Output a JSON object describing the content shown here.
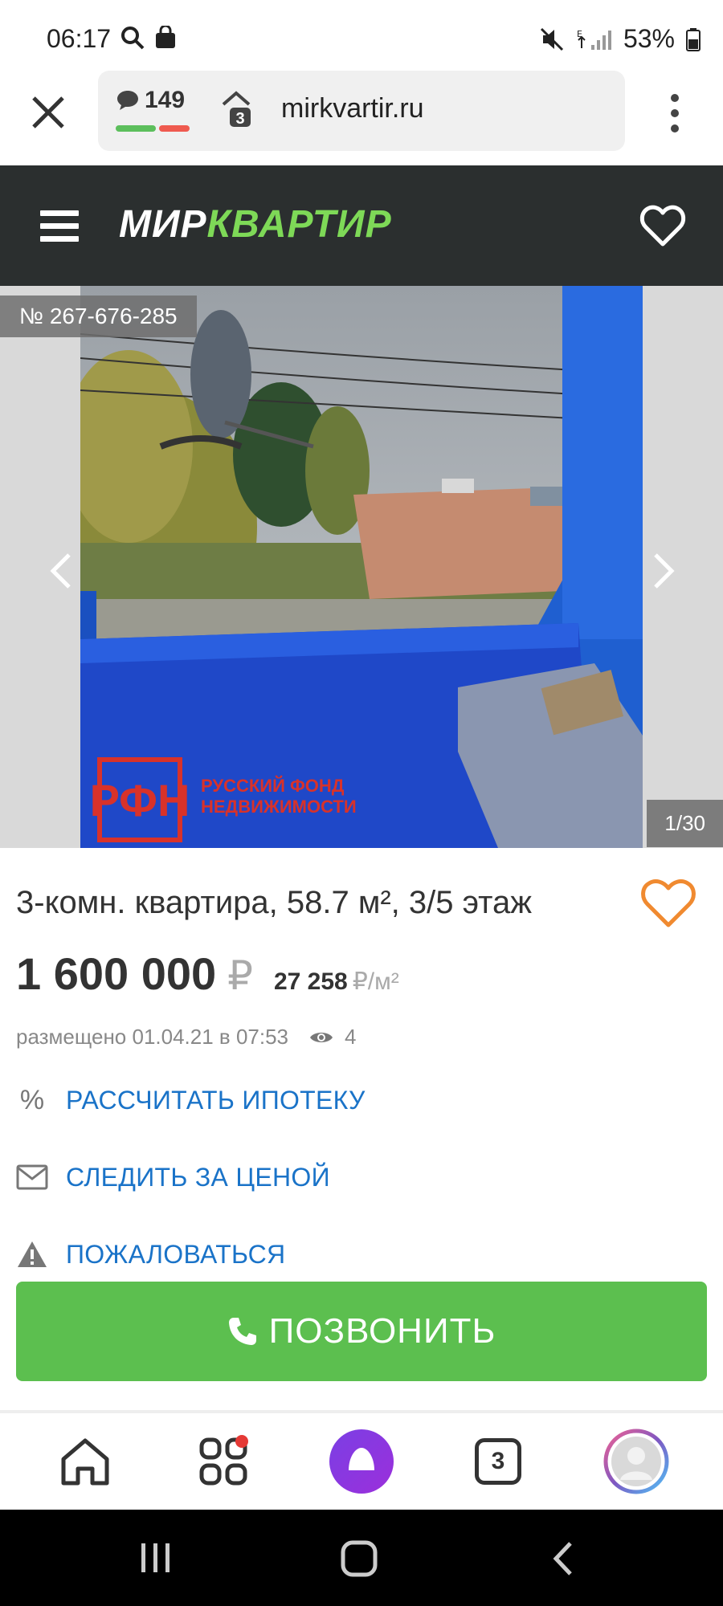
{
  "status_bar": {
    "time": "06:17",
    "battery": "53%"
  },
  "browser": {
    "comments_count": "149",
    "tabs_badge": "3",
    "url": "mirkvartir.ru"
  },
  "site": {
    "logo_part1": "МИР",
    "logo_part2": "КВАРТИР",
    "accent_color": "#7ed957"
  },
  "gallery": {
    "listing_id": "№ 267-676-285",
    "counter": "1/30",
    "watermark": "РУССКИЙ ФОНД НЕДВИЖИМОСТИ"
  },
  "listing": {
    "title": "3-комн. квартира, 58.7 м², 3/5 этаж",
    "price": "1 600 000",
    "currency": "₽",
    "price_per_m": "27 258",
    "price_per_m_unit": "₽/м²",
    "posted": "размещено 01.04.21 в 07:53",
    "views": "4"
  },
  "actions": {
    "mortgage_icon": "%",
    "mortgage": "РАССЧИТАТЬ ИПОТЕКУ",
    "track_price": "СЛЕДИТЬ ЗА ЦЕНОЙ",
    "report": "ПОЖАЛОВАТЬСЯ",
    "call": "ПОЗВОНИТЬ"
  },
  "bottom_nav": {
    "tabs_count": "3"
  },
  "icons": [
    "search-icon",
    "bag-icon",
    "mute-icon",
    "signal-icon",
    "battery-icon",
    "close-icon",
    "chat-icon",
    "shield-icon",
    "more-icon",
    "menu-icon",
    "heart-icon",
    "chevron-left-icon",
    "chevron-right-icon",
    "eye-icon",
    "percent-icon",
    "mail-icon",
    "warning-icon",
    "phone-icon",
    "home-icon",
    "apps-icon",
    "alice-icon",
    "tabs-icon",
    "profile-icon"
  ]
}
